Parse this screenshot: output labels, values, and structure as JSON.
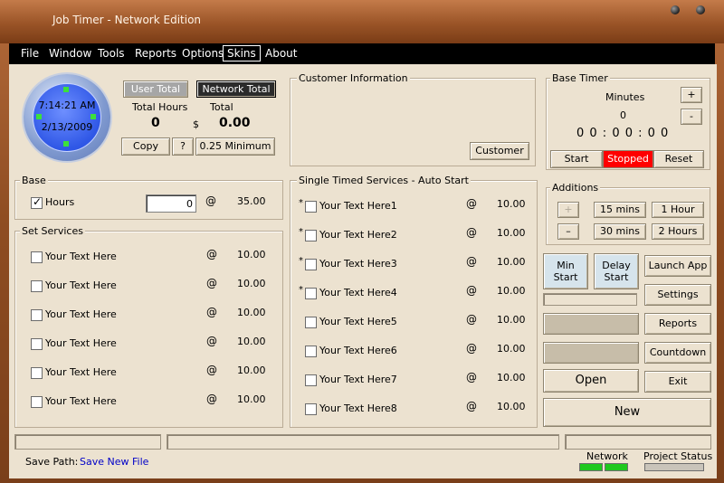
{
  "window": {
    "title": "Job Timer - Network Edition"
  },
  "menu": [
    "File",
    "Window",
    "Tools",
    "Reports",
    "Options",
    "Skins",
    "About"
  ],
  "clock": {
    "time": "7:14:21 AM",
    "date": "2/13/2009"
  },
  "totals": {
    "user_total_label": "User Total",
    "network_total_label": "Network Total",
    "total_hours_label": "Total Hours",
    "total_label": "Total",
    "hours_value": "0",
    "currency": "$",
    "amount_value": "0.00",
    "copy_label": "Copy",
    "help_label": "?",
    "minimum_label": "0.25 Minimum"
  },
  "customer": {
    "title": "Customer Information",
    "button_label": "Customer"
  },
  "base_timer": {
    "title": "Base Timer",
    "minutes_label": "Minutes",
    "minutes_value": "0",
    "plus_label": "+",
    "minus_label": "-",
    "display": "0 0 : 0 0 : 0 0",
    "start_label": "Start",
    "status_label": "Stopped",
    "reset_label": "Reset"
  },
  "base": {
    "title": "Base",
    "hours_label": "Hours",
    "hours_input": "0",
    "at": "@",
    "rate": "35.00"
  },
  "set_services": {
    "title": "Set Services",
    "items": [
      {
        "label": "Your Text Here",
        "at": "@",
        "rate": "10.00"
      },
      {
        "label": "Your Text Here",
        "at": "@",
        "rate": "10.00"
      },
      {
        "label": "Your Text Here",
        "at": "@",
        "rate": "10.00"
      },
      {
        "label": "Your Text Here",
        "at": "@",
        "rate": "10.00"
      },
      {
        "label": "Your Text Here",
        "at": "@",
        "rate": "10.00"
      },
      {
        "label": "Your Text Here",
        "at": "@",
        "rate": "10.00"
      }
    ]
  },
  "timed_services": {
    "title": "Single Timed Services - Auto Start",
    "items": [
      {
        "star": "*",
        "label": "Your Text Here1",
        "at": "@",
        "rate": "10.00"
      },
      {
        "star": "*",
        "label": "Your Text Here2",
        "at": "@",
        "rate": "10.00"
      },
      {
        "star": "*",
        "label": "Your Text Here3",
        "at": "@",
        "rate": "10.00"
      },
      {
        "star": "*",
        "label": "Your Text Here4",
        "at": "@",
        "rate": "10.00"
      },
      {
        "star": "",
        "label": "Your Text Here5",
        "at": "@",
        "rate": "10.00"
      },
      {
        "star": "",
        "label": "Your Text Here6",
        "at": "@",
        "rate": "10.00"
      },
      {
        "star": "",
        "label": "Your Text Here7",
        "at": "@",
        "rate": "10.00"
      },
      {
        "star": "",
        "label": "Your Text Here8",
        "at": "@",
        "rate": "10.00"
      }
    ]
  },
  "additions": {
    "title": "Additions",
    "plus_label": "+",
    "minus_label": "–",
    "b15": "15 mins",
    "b1h": "1 Hour",
    "b30": "30 mins",
    "b2h": "2 Hours"
  },
  "actions": {
    "min_start": "Min\nStart",
    "delay_start": "Delay\nStart",
    "launch_app": "Launch App",
    "settings": "Settings",
    "reports": "Reports",
    "countdown": "Countdown",
    "open": "Open",
    "exit": "Exit",
    "new": "New"
  },
  "status": {
    "save_path_label": "Save Path:",
    "save_path_value": "Save New File",
    "network_label": "Network",
    "project_status_label": "Project Status"
  },
  "colors": {
    "stopped_bg": "#ff0000",
    "network_led": "#1ec81e",
    "link": "#0000c8"
  }
}
